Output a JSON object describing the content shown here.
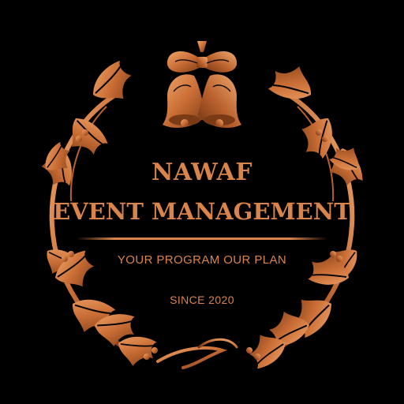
{
  "logo": {
    "name": "NAWAF",
    "subtitle": "EVENT MANAGEMENT",
    "tagline": "YOUR PROGRAM OUR PLAN",
    "since": "SINCE 2020"
  },
  "colors": {
    "background": "#000000",
    "accent": "#d9844a",
    "accent_dark": "#7a3a16",
    "accent_light": "#f0a66a"
  },
  "icons": [
    "bell-icon",
    "bow-icon",
    "holly-leaf-icon",
    "holly-berry-icon"
  ]
}
